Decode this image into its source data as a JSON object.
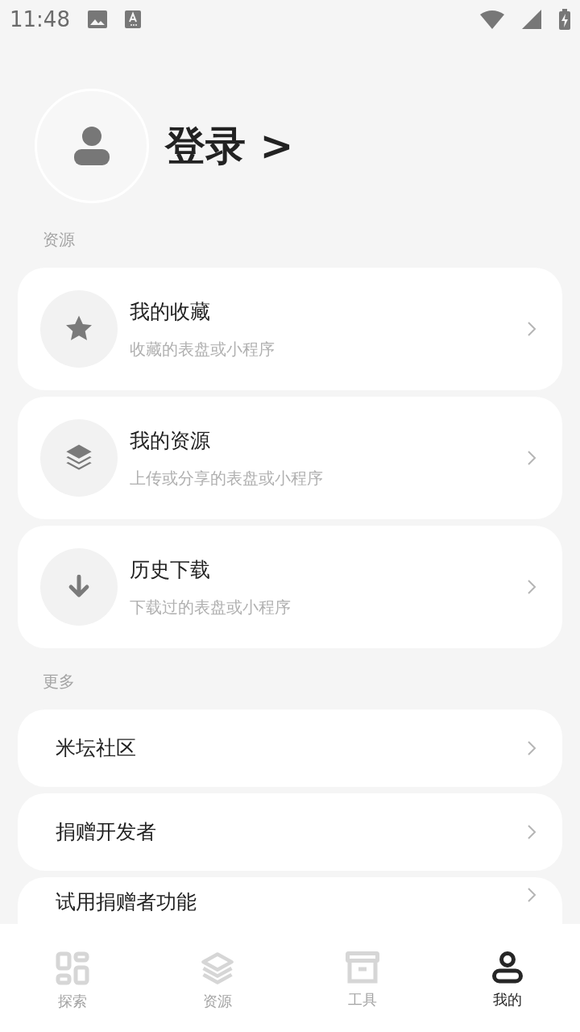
{
  "status_bar": {
    "time": "11:48"
  },
  "profile": {
    "login_label": "登录 >"
  },
  "sections": [
    {
      "title": "资源",
      "items": [
        {
          "kind": "detailed",
          "title": "我的收藏",
          "subtitle": "收藏的表盘或小程序"
        },
        {
          "kind": "detailed",
          "title": "我的资源",
          "subtitle": "上传或分享的表盘或小程序"
        },
        {
          "kind": "detailed",
          "title": "历史下载",
          "subtitle": "下载过的表盘或小程序"
        }
      ]
    },
    {
      "title": "更多",
      "items": [
        {
          "kind": "simple",
          "title": "米坛社区"
        },
        {
          "kind": "simple",
          "title": "捐赠开发者"
        },
        {
          "kind": "simple",
          "title": "试用捐赠者功能"
        }
      ]
    }
  ],
  "bottom_nav": [
    {
      "label": "探索",
      "selected": false
    },
    {
      "label": "资源",
      "selected": false
    },
    {
      "label": "工具",
      "selected": false
    },
    {
      "label": "我的",
      "selected": true
    }
  ]
}
